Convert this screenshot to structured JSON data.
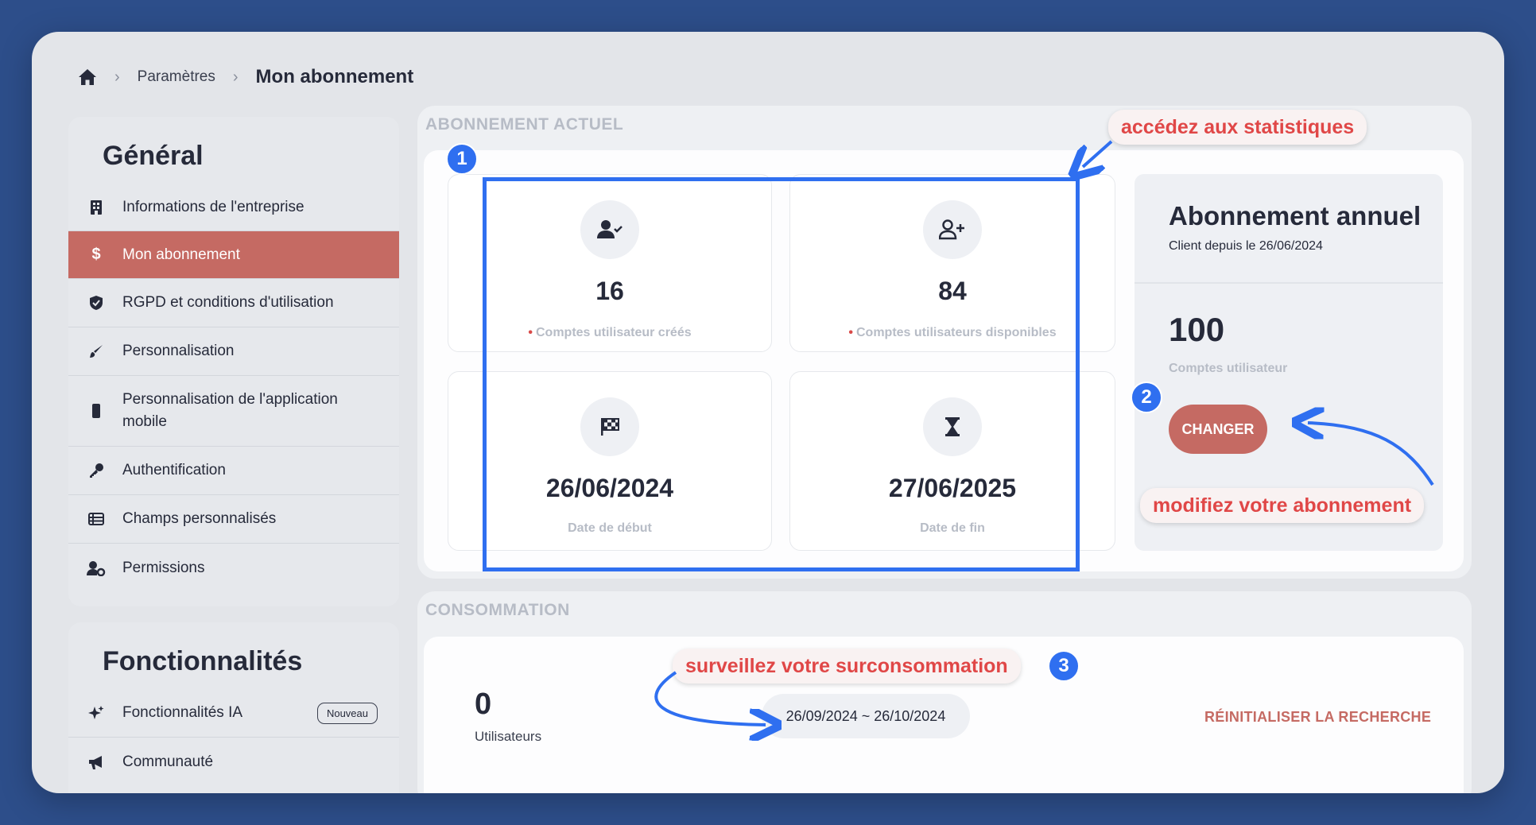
{
  "breadcrumb": {
    "home_icon": "home-icon",
    "parent": "Paramètres",
    "current": "Mon abonnement"
  },
  "sidebar": {
    "general_title": "Général",
    "items": [
      {
        "label": "Informations de l'entreprise",
        "icon": "building-icon"
      },
      {
        "label": "Mon abonnement",
        "icon": "dollar-icon",
        "active": true
      },
      {
        "label": "RGPD et conditions d'utilisation",
        "icon": "shield-icon"
      },
      {
        "label": "Personnalisation",
        "icon": "brush-icon"
      },
      {
        "label": "Personnalisation de l'application mobile",
        "icon": "mobile-icon"
      },
      {
        "label": "Authentification",
        "icon": "key-icon"
      },
      {
        "label": "Champs personnalisés",
        "icon": "table-icon"
      },
      {
        "label": "Permissions",
        "icon": "user-gear-icon"
      }
    ],
    "features_title": "Fonctionnalités",
    "feature_items": [
      {
        "label": "Fonctionnalités IA",
        "icon": "sparkles-icon",
        "badge": "Nouveau"
      },
      {
        "label": "Communauté",
        "icon": "megaphone-icon"
      }
    ]
  },
  "subscription": {
    "section_label": "ABONNEMENT ACTUEL",
    "stats": [
      {
        "value": "16",
        "caption": "Comptes utilisateur créés",
        "icon": "user-check-icon",
        "dot": true
      },
      {
        "value": "84",
        "caption": "Comptes utilisateurs disponibles",
        "icon": "user-plus-icon",
        "dot": true
      },
      {
        "value": "26/06/2024",
        "caption": "Date de début",
        "icon": "flag-checkered-icon",
        "dot": false
      },
      {
        "value": "27/06/2025",
        "caption": "Date de fin",
        "icon": "hourglass-icon",
        "dot": false
      }
    ],
    "plan": {
      "title": "Abonnement annuel",
      "since": "Client depuis le 26/06/2024",
      "count": "100",
      "count_caption": "Comptes utilisateur",
      "change_button": "CHANGER"
    }
  },
  "consumption": {
    "section_label": "CONSOMMATION",
    "users_count": "0",
    "users_caption": "Utilisateurs",
    "date_range": "26/09/2024 ~ 26/10/2024",
    "reset_link": "RÉINITIALISER LA RECHERCHE"
  },
  "annotations": {
    "callout_1": "accédez aux statistiques",
    "callout_2": "modifiez votre abonnement",
    "callout_3": "surveillez votre surconsommation",
    "badge_1": "1",
    "badge_2": "2",
    "badge_3": "3",
    "accent_color": "#2f6ff0",
    "callout_color": "#e04747"
  }
}
